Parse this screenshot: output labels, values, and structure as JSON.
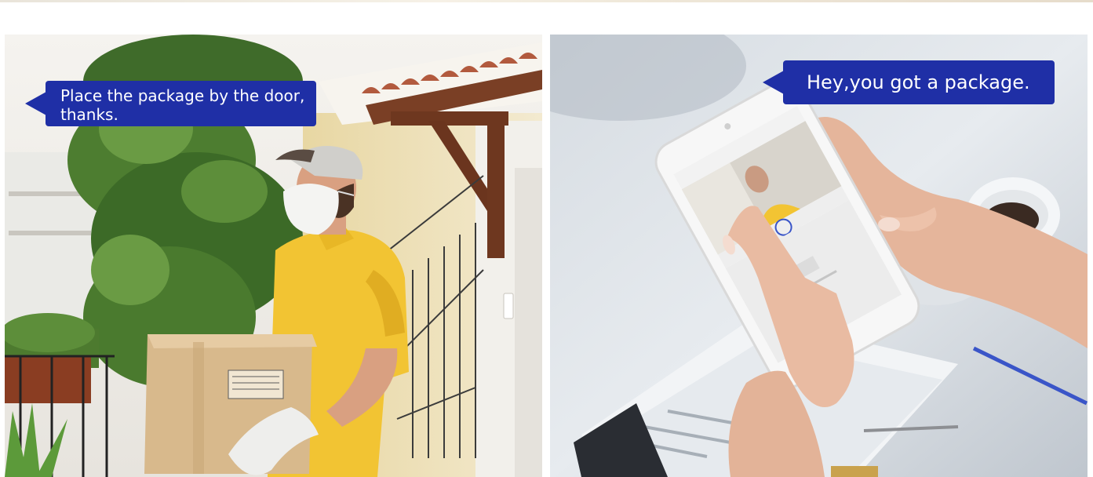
{
  "left_panel": {
    "speech_bubble": "Place the package by the door, thanks."
  },
  "right_panel": {
    "speech_bubble": "Hey,you got a package."
  },
  "colors": {
    "bubble": "#1f2fa6",
    "bubble_text": "#ffffff",
    "shirt": "#f2c433",
    "box": "#d8b98c"
  },
  "icons": [
    "delivery-box-icon",
    "smartphone-icon"
  ]
}
